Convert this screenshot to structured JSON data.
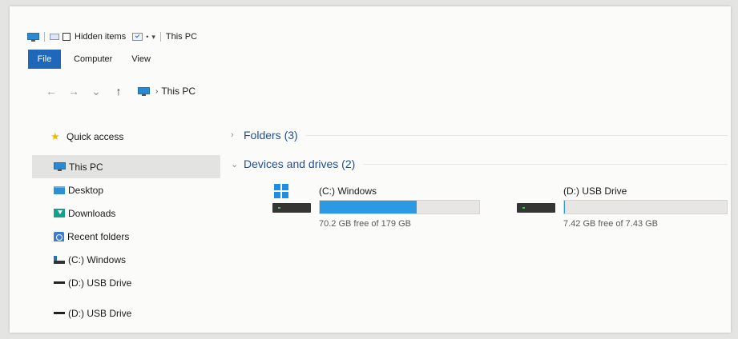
{
  "titlebar": {
    "hidden_items_label": "Hidden items",
    "title": "This PC",
    "icons": [
      "pc-icon",
      "properties-icon",
      "qa-dropdown-icon"
    ]
  },
  "ribbon": {
    "tabs": [
      {
        "label": "File",
        "active": true
      },
      {
        "label": "Computer"
      },
      {
        "label": "View"
      }
    ],
    "accent": "#1f67b8"
  },
  "address": {
    "back_glyph": "←",
    "forward_glyph": "→",
    "recent_glyph": "⌄",
    "up_glyph": "↑",
    "crumb_separator": "›",
    "location": "This PC"
  },
  "sidebar": {
    "items": [
      {
        "label": "Quick access",
        "icon": "star-icon"
      },
      {
        "label": "This PC",
        "icon": "pc-icon",
        "selected": true
      },
      {
        "label": "Desktop",
        "icon": "desktop-folder-icon"
      },
      {
        "label": "Downloads",
        "icon": "downloads-folder-icon"
      },
      {
        "label": "Recent folders",
        "icon": "recent-folders-icon"
      },
      {
        "label": "(C:) Windows",
        "icon": "c-drive-icon"
      },
      {
        "label": "(D:) USB Drive",
        "icon": "usb-drive-icon"
      },
      {
        "label": "(D:) USB Drive",
        "icon": "usb-drive-icon"
      }
    ]
  },
  "content": {
    "groups": [
      {
        "label": "Folders (3)",
        "chevron": "›",
        "expanded": false
      },
      {
        "label": "Devices and drives (2)",
        "chevron": "⌄",
        "expanded": true
      }
    ],
    "drives": [
      {
        "name": "(C:) Windows",
        "free_text": "70.2 GB free of 179 GB",
        "used_fraction": 0.61,
        "bar_color": "#2c9ae2",
        "icon": "windows-drive-icon"
      },
      {
        "name": "(D:) USB Drive",
        "free_text": "7.42 GB free of 7.43 GB",
        "used_fraction": 0.001,
        "bar_color": "#2c9ae2",
        "icon": "usb-drive-icon"
      }
    ]
  }
}
